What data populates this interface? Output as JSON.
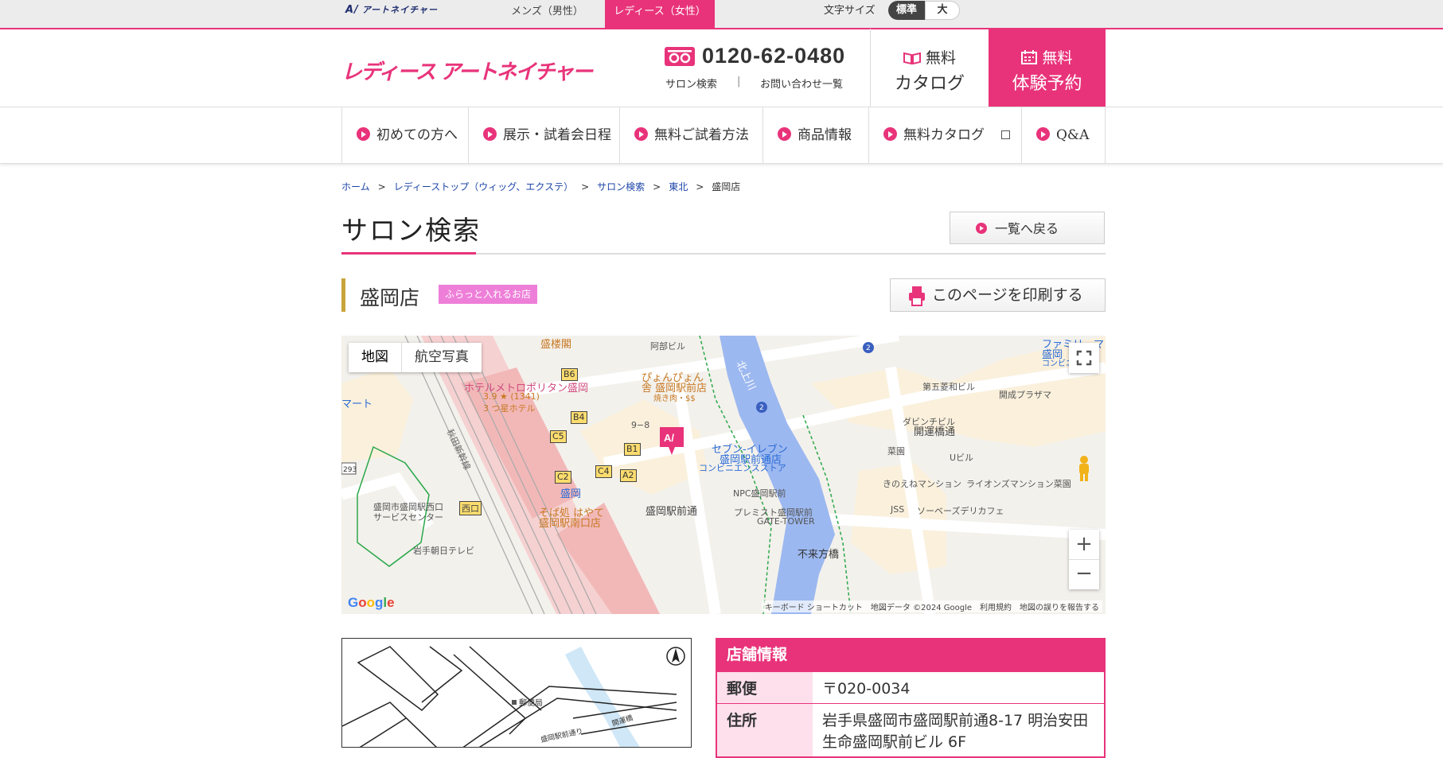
{
  "topbar": {
    "small_logo": "アートネイチャー",
    "tab_mens": "メンズ（男性）",
    "tab_ladies": "レディース（女性）",
    "font_size_label": "文字サイズ",
    "font_size_standard": "標準",
    "font_size_large": "大"
  },
  "header": {
    "brand": "レディース アートネイチャー",
    "phone": "0120-62-0480",
    "salon_search": "サロン検索",
    "separator": "|",
    "contact": "お問い合わせ一覧",
    "catalog_line1": "無料",
    "catalog_line2": "カタログ",
    "booking_line1": "無料",
    "booking_line2": "体験予約"
  },
  "nav": [
    "初めての方へ",
    "展示・試着会日程",
    "無料ご試着方法",
    "商品情報",
    "無料カタログ",
    "Q&A"
  ],
  "breadcrumb": {
    "items": [
      "ホーム",
      "レディーストップ（ウィッグ、エクステ）",
      "サロン検索",
      "東北"
    ],
    "current": "盛岡店",
    "sep": ">"
  },
  "page": {
    "title": "サロン検索",
    "back_button": "一覧へ戻る",
    "store_name": "盛岡店",
    "store_badge": "ふらっと入れるお店",
    "print_button": "このページを印刷する"
  },
  "map": {
    "tab_map": "地図",
    "tab_satellite": "航空写真",
    "footer": "キーボード ショートカット　地図データ ©2024 Google　利用規約　地図の誤りを報告する",
    "google": "Google",
    "labels": {
      "hotel": "ホテルメトロポリタン盛岡",
      "hotel_rating": "3.9 ★ (1341)",
      "hotel_class": "3 つ星ホテル",
      "pyonpyon": "ぴょんぴょん",
      "pyonpyon2": "舎 盛岡駅前店",
      "yakiniku": "焼き肉・$$",
      "seven": "セブン-イレブン",
      "seven2": "盛岡駅前通店",
      "seven3": "コンビニエンスストア",
      "sobadokoro": "そば処 はやて",
      "sobadokoro2": "盛岡駅南口店",
      "morioka": "盛岡",
      "ekimae": "盛岡駅前通",
      "npc": "NPC盛岡駅前",
      "premist": "プレミスト盛岡駅前",
      "premist2": "GATE-TOWER",
      "kitakami": "北上川",
      "fukita": "不来方橋",
      "kaiun": "開運橋通",
      "daigo": "第五菱和ビル",
      "kaisei": "開成プラザマ",
      "dabinchi": "ダビンチビル",
      "saien": "菜園",
      "ubiru": "Uビル",
      "kinoene": "きのえねマンション",
      "lions": "ライオンズマンション菜園",
      "jss": "JSS",
      "sobes": "ソーベーズデリカフェ",
      "iwate_tv": "岩手朝日テレビ",
      "west_service": "盛岡市盛岡駅西口",
      "west_service2": "サービスセンター",
      "nishiguchi": "西口",
      "family": "ファミリーマ",
      "family2": "盛岡",
      "family3": "コンビニ",
      "morosho": "盛楼閣",
      "abe": "阿部ビル",
      "mart": "マート",
      "ohno": "9−8",
      "akita": "秋田新幹線",
      "route293": "293",
      "route2": "2"
    }
  },
  "info": {
    "heading": "店舗情報",
    "rows": [
      {
        "k": "郵便",
        "v": "〒020-0034"
      },
      {
        "k": "住所",
        "v": "岩手県盛岡市盛岡駅前通8-17 明治安田生命盛岡駅前ビル 6F"
      }
    ]
  },
  "simple_map": {
    "post_office": "郵便局",
    "street": "盛岡駅前通り",
    "bridge": "開運橋"
  },
  "colors": {
    "accent": "#e8337a",
    "gold": "#c8a43a",
    "badge": "#ee7fd8"
  }
}
